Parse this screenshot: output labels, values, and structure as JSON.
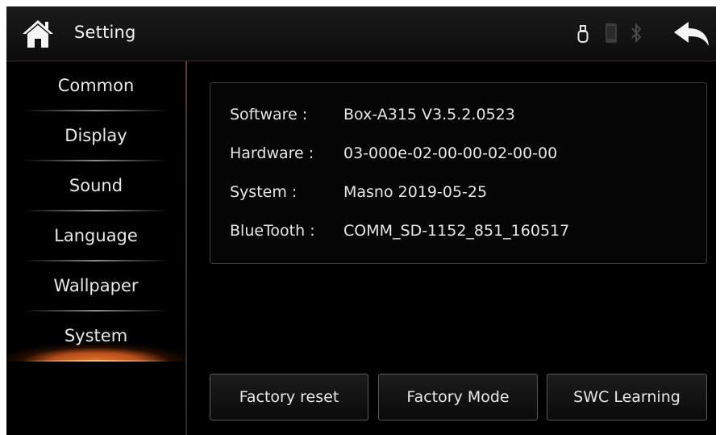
{
  "header": {
    "title": "Setting",
    "icons": [
      "home-icon",
      "usb-icon",
      "phone-icon",
      "bluetooth-icon",
      "back-arrow-icon"
    ],
    "accent": "#e8792a"
  },
  "sidebar": {
    "items": [
      {
        "label": "Common"
      },
      {
        "label": "Display"
      },
      {
        "label": "Sound"
      },
      {
        "label": "Language"
      },
      {
        "label": "Wallpaper"
      },
      {
        "label": "System",
        "active": true
      }
    ]
  },
  "info": {
    "rows": [
      {
        "key": "Software :",
        "value": "Box-A315 V3.5.2.0523"
      },
      {
        "key": "Hardware :",
        "value": "03-000e-02-00-00-02-00-00"
      },
      {
        "key": "System :",
        "value": "Masno 2019-05-25"
      },
      {
        "key": "BlueTooth :",
        "value": "COMM_SD-1152_851_160517"
      }
    ]
  },
  "actions": {
    "factory_reset": "Factory reset",
    "factory_mode": "Factory Mode",
    "swc_learning": "SWC Learning"
  }
}
